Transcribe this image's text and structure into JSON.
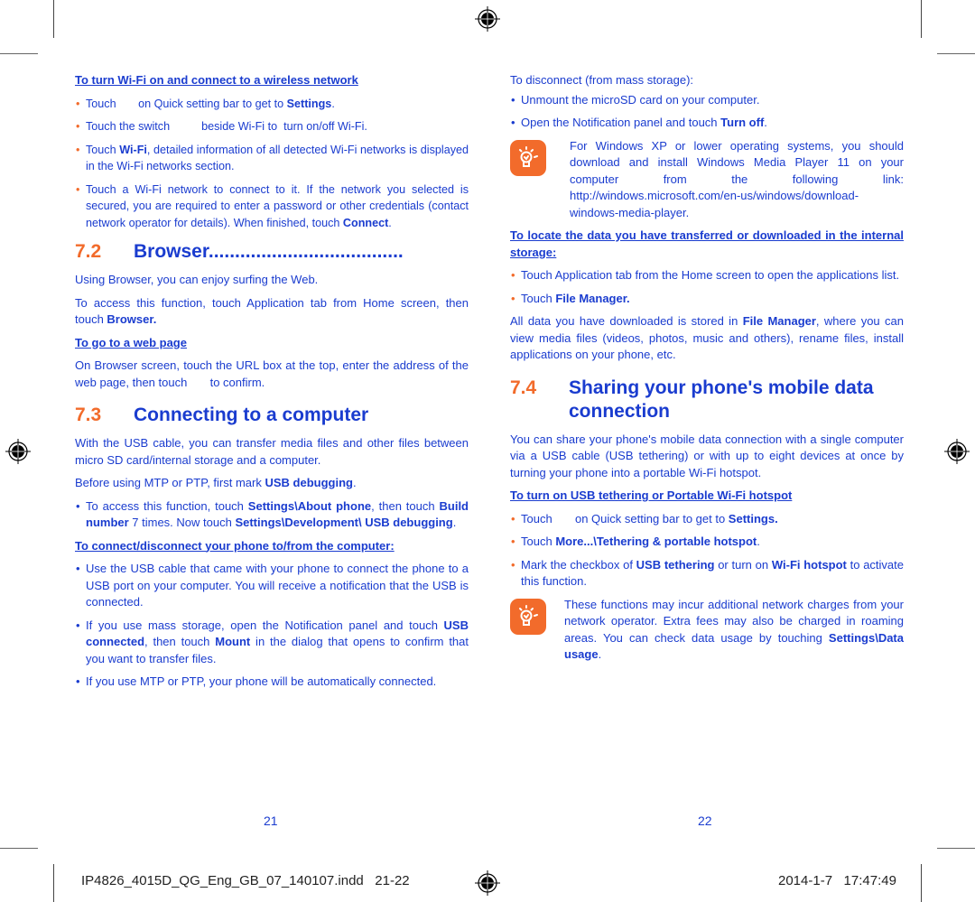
{
  "left_page": {
    "wifi": {
      "heading": "To turn Wi-Fi on and connect to a wireless network",
      "items": [
        {
          "parts": [
            {
              "t": "Touch       on Quick setting bar to get to "
            },
            {
              "t": "Settings",
              "b": true
            },
            {
              "t": "."
            }
          ]
        },
        {
          "parts": [
            {
              "t": "Touch the switch          beside Wi-Fi to  turn on/off Wi-Fi."
            }
          ]
        },
        {
          "parts": [
            {
              "t": "Touch "
            },
            {
              "t": "Wi-Fi",
              "b": true
            },
            {
              "t": ", detailed information of all detected Wi-Fi networks is displayed in the Wi-Fi networks section."
            }
          ]
        },
        {
          "parts": [
            {
              "t": "Touch a Wi-Fi network to connect to it. If the network you selected is secured, you are required to enter a password or other credentials (contact network operator for details). When finished, touch "
            },
            {
              "t": "Connect",
              "b": true
            },
            {
              "t": "."
            }
          ]
        }
      ]
    },
    "browser": {
      "number": "7.2",
      "title": "Browser.....................................",
      "intro": "Using Browser, you can enjoy surfing the Web.",
      "access": [
        {
          "t": "To access this function, touch Application tab from Home screen, then touch "
        },
        {
          "t": "Browser.",
          "b": true
        }
      ],
      "subheading": "To go to a web page",
      "goto": "On Browser screen, touch the URL box at the top, enter the address of the web page, then touch       to confirm."
    },
    "computer": {
      "number": "7.3",
      "title": "Connecting to a computer",
      "intro": "With the USB cable, you can transfer media files and other files between micro SD card/internal storage and a computer.",
      "before": [
        {
          "t": "Before using MTP or PTP, first mark "
        },
        {
          "t": "USB debugging",
          "b": true
        },
        {
          "t": "."
        }
      ],
      "access_item": [
        {
          "t": "To access this function, touch "
        },
        {
          "t": "Settings\\About phone",
          "b": true
        },
        {
          "t": ", then touch "
        },
        {
          "t": "Build number",
          "b": true
        },
        {
          "t": " 7 times. Now touch "
        },
        {
          "t": "Settings\\Development\\ USB debugging",
          "b": true
        },
        {
          "t": "."
        }
      ],
      "subheading": "To connect/disconnect your phone to/from the computer:",
      "items": [
        {
          "parts": [
            {
              "t": "Use the USB cable that came with your phone to connect the phone to a USB port on your computer. You will receive a notification that the USB is connected."
            }
          ]
        },
        {
          "parts": [
            {
              "t": "If you use mass storage, open the Notification panel and touch "
            },
            {
              "t": "USB connected",
              "b": true
            },
            {
              "t": ", then touch "
            },
            {
              "t": "Mount",
              "b": true
            },
            {
              "t": " in the dialog that opens to confirm that you want to transfer files."
            }
          ]
        },
        {
          "parts": [
            {
              "t": "If you use MTP or PTP, your phone will be automatically connected."
            }
          ]
        }
      ]
    },
    "page_number": "21"
  },
  "right_page": {
    "disconnect": {
      "intro": "To disconnect (from mass storage):",
      "items": [
        {
          "parts": [
            {
              "t": "Unmount the microSD card on your computer."
            }
          ]
        },
        {
          "parts": [
            {
              "t": "Open the Notification panel and touch "
            },
            {
              "t": "Turn off",
              "b": true
            },
            {
              "t": "."
            }
          ]
        }
      ]
    },
    "tip1": "For Windows XP or lower operating systems, you should download and install Windows Media Player 11 on your computer from the following link: http://windows.microsoft.com/en-us/windows/download-windows-media-player.",
    "locate": {
      "heading": "To locate the data you have transferred or downloaded in the internal storage:",
      "items": [
        {
          "parts": [
            {
              "t": "Touch Application tab from the Home screen to open the applications list."
            }
          ]
        },
        {
          "parts": [
            {
              "t": "Touch "
            },
            {
              "t": "File Manager.",
              "b": true
            }
          ]
        }
      ],
      "body": [
        {
          "t": "All data you have downloaded is stored in "
        },
        {
          "t": "File Manager",
          "b": true
        },
        {
          "t": ", where you can view media files (videos, photos, music and others), rename files, install applications on your phone, etc."
        }
      ]
    },
    "sharing": {
      "number": "7.4",
      "title": "Sharing your phone's mobile data connection",
      "intro": "You can share your phone's mobile data connection with a single computer via a USB cable (USB tethering) or with up to eight devices at once by turning your phone into a portable Wi-Fi hotspot.",
      "subheading": "To turn on USB tethering or Portable Wi-Fi hotspot",
      "items": [
        {
          "parts": [
            {
              "t": "Touch       on Quick setting bar to get to "
            },
            {
              "t": "Settings.",
              "b": true
            }
          ]
        },
        {
          "parts": [
            {
              "t": "Touch "
            },
            {
              "t": "More...\\Tethering & portable hotspot",
              "b": true
            },
            {
              "t": "."
            }
          ]
        },
        {
          "parts": [
            {
              "t": "Mark the checkbox of "
            },
            {
              "t": "USB tethering",
              "b": true
            },
            {
              "t": " or turn on "
            },
            {
              "t": "Wi-Fi hotspot",
              "b": true
            },
            {
              "t": " to activate this function."
            }
          ]
        }
      ]
    },
    "tip2": [
      {
        "t": "These functions may incur additional network charges from your network operator. Extra fees may also be charged in roaming areas. You can check data usage by touching "
      },
      {
        "t": "Settings\\Data usage",
        "b": true
      },
      {
        "t": "."
      }
    ],
    "page_number": "22"
  },
  "slug": {
    "filename": "IP4826_4015D_QG_Eng_GB_07_140107.indd   21-22",
    "datetime": "2014-1-7   17:47:49"
  },
  "colors": {
    "accent_orange": "#f26b2b",
    "text_blue": "#1a3ccf"
  }
}
